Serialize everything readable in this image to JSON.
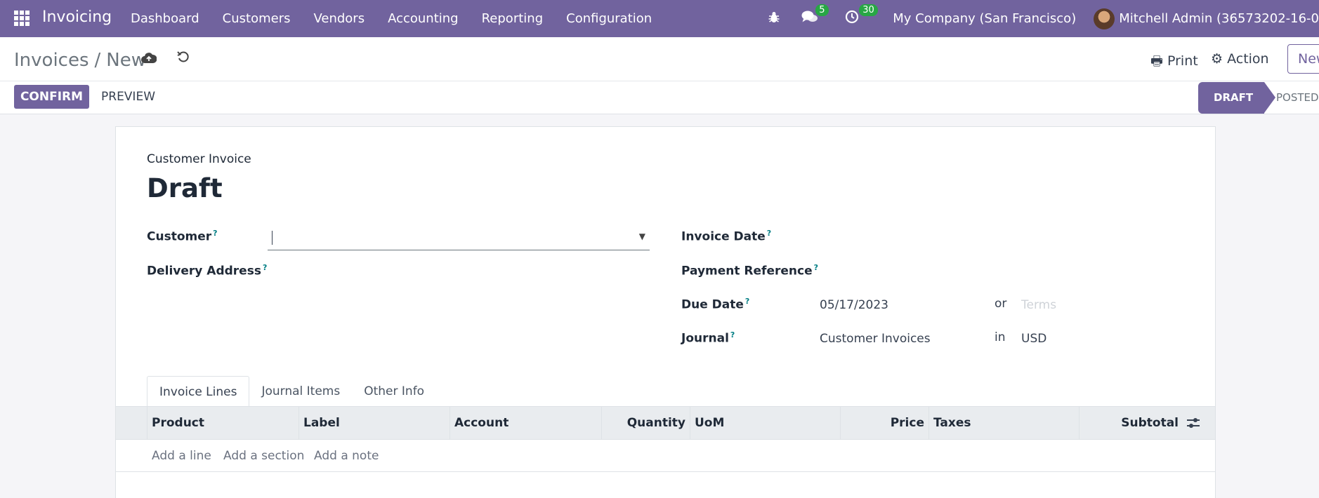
{
  "navbar": {
    "app_title": "Invoicing",
    "menu": [
      "Dashboard",
      "Customers",
      "Vendors",
      "Accounting",
      "Reporting",
      "Configuration"
    ],
    "messages_count": "5",
    "activities_count": "30",
    "company": "My Company (San Francisco)",
    "user": "Mitchell Admin (36573202-16-0"
  },
  "breadcrumb": {
    "parent": "Invoices",
    "separator": "/",
    "current": "New"
  },
  "toolbar": {
    "print_label": "Print",
    "action_label": "Action",
    "new_label": "New"
  },
  "buttons": {
    "confirm": "CONFIRM",
    "preview": "PREVIEW"
  },
  "status": {
    "draft": "DRAFT",
    "posted": "POSTED"
  },
  "form": {
    "doc_type": "Customer Invoice",
    "title": "Draft",
    "customer_label": "Customer",
    "delivery_label": "Delivery Address",
    "invoice_date_label": "Invoice Date",
    "payment_ref_label": "Payment Reference",
    "due_date_label": "Due Date",
    "due_date_value": "05/17/2023",
    "or_text": "or",
    "terms_placeholder": "Terms",
    "journal_label": "Journal",
    "journal_value": "Customer Invoices",
    "in_text": "in",
    "currency_value": "USD",
    "help_mark": "?"
  },
  "tabs": [
    "Invoice Lines",
    "Journal Items",
    "Other Info"
  ],
  "table": {
    "columns": [
      "Product",
      "Label",
      "Account",
      "Quantity",
      "UoM",
      "Price",
      "Taxes",
      "Subtotal"
    ],
    "add_line": "Add a line",
    "add_section": "Add a section",
    "add_note": "Add a note"
  }
}
